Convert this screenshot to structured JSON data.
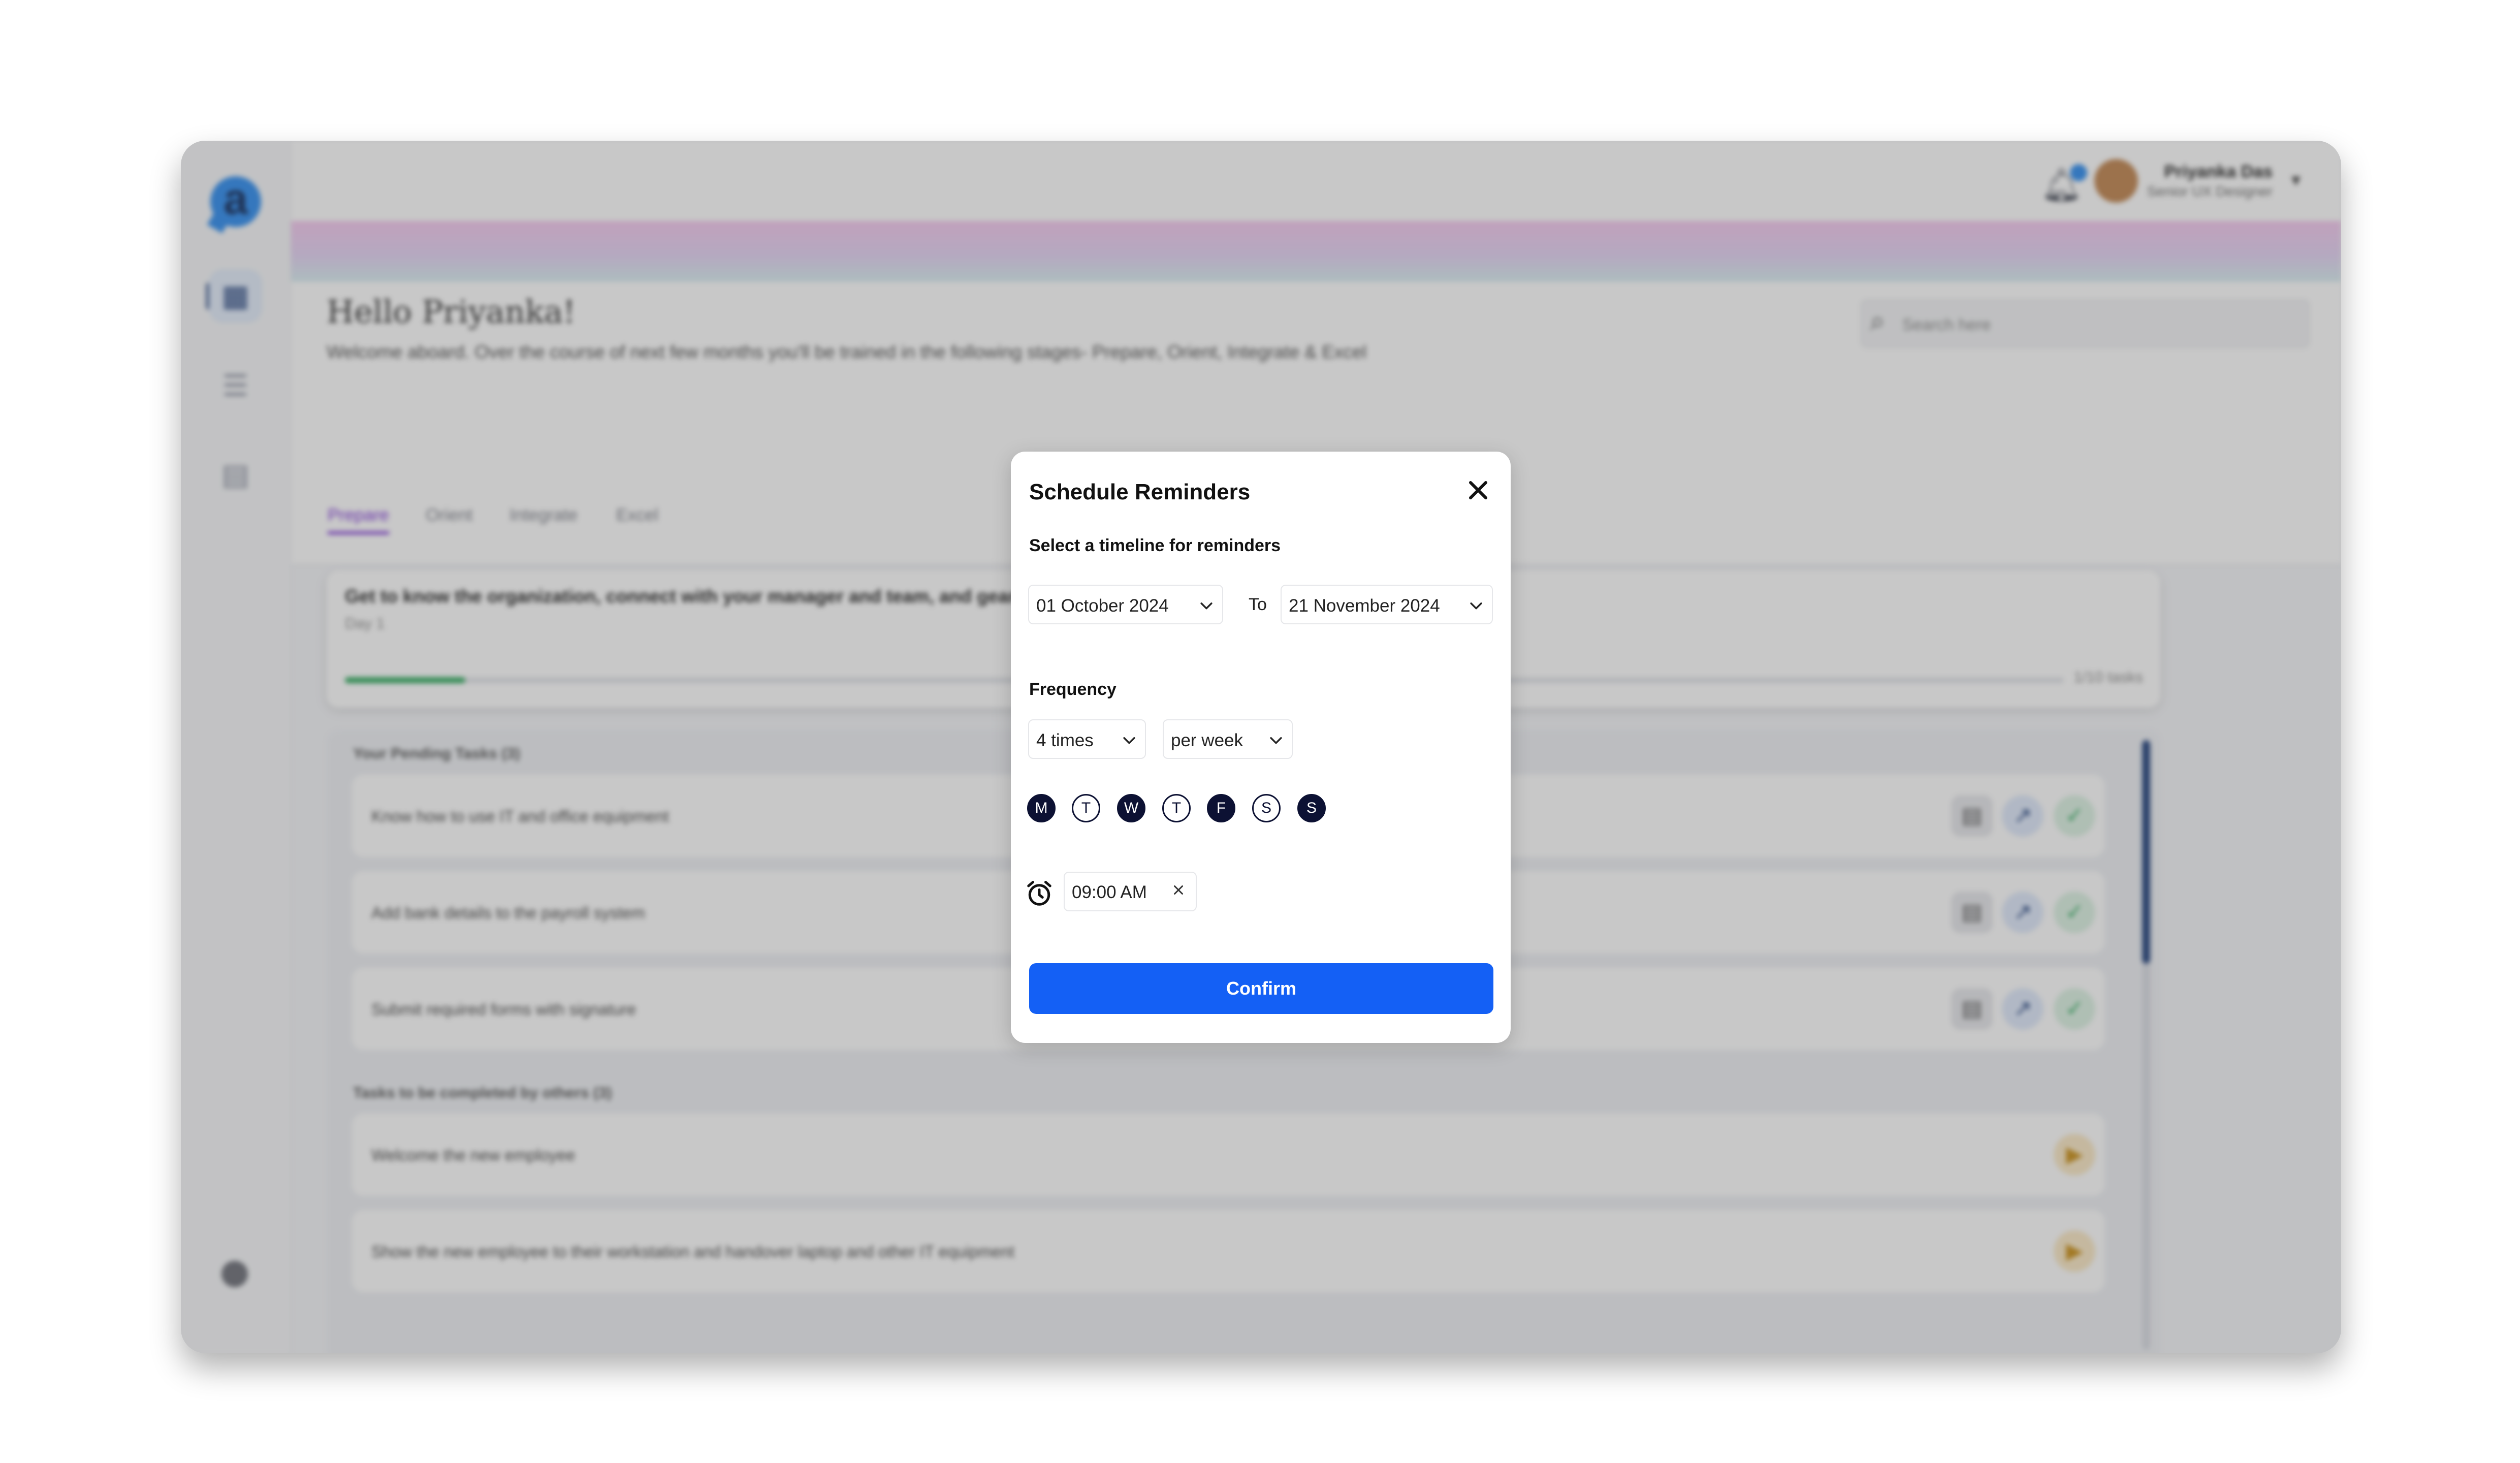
{
  "app": {
    "logo": "a",
    "user": {
      "name": "Priyanka Das",
      "role": "Senior UX Designer"
    },
    "greeting": "Hello Priyanka!",
    "welcome": "Welcome aboard. Over the course of next few months you'll be trained in the following stages- Prepare, Orient, Integrate & Excel",
    "search_placeholder": "Search here",
    "tabs": [
      "Prepare",
      "Orient",
      "Integrate",
      "Excel"
    ],
    "stage_card": {
      "text": "Get to know the organization, connect with your manager and team, and gear up",
      "day": "Day 1",
      "progress_text": "1/10 tasks",
      "progress_fraction": 0.07
    },
    "pending_title": "Your Pending Tasks (3)",
    "pending_tasks": [
      "Know how to use IT and office equipment",
      "Add bank details to the payroll system",
      "Submit required forms with signature"
    ],
    "others_title": "Tasks to be completed by others (3)",
    "others_tasks": [
      "Welcome the new employee",
      "Show the new employee to their workstation and handover laptop and other IT equipment"
    ]
  },
  "modal": {
    "title": "Schedule Reminders",
    "timeline_label": "Select a timeline for reminders",
    "from_date": "01 October 2024",
    "to_label": "To",
    "to_date": "21 November 2024",
    "frequency_label": "Frequency",
    "times": "4 times",
    "period": "per week",
    "days": [
      {
        "letter": "M",
        "selected": true
      },
      {
        "letter": "T",
        "selected": false
      },
      {
        "letter": "W",
        "selected": true
      },
      {
        "letter": "T",
        "selected": false
      },
      {
        "letter": "F",
        "selected": true
      },
      {
        "letter": "S",
        "selected": false
      },
      {
        "letter": "S",
        "selected": true
      }
    ],
    "time": "09:00 AM",
    "confirm_label": "Confirm"
  },
  "icons": {
    "close": "close-icon",
    "chevron": "chevron-down-icon",
    "alarm": "alarm-clock-icon",
    "clear": "clear-icon"
  },
  "colors": {
    "primary_button": "#1460f5",
    "day_selected": "#0c1133",
    "tab_active": "#7a2fd6"
  }
}
